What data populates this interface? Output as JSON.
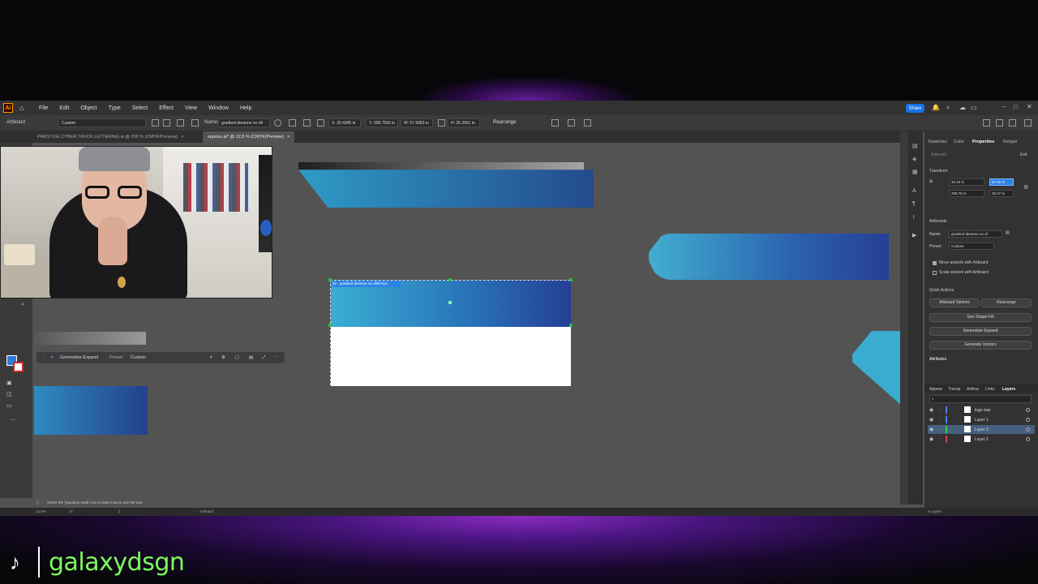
{
  "app": {
    "logo": "Ai"
  },
  "menu": [
    "File",
    "Edit",
    "Object",
    "Type",
    "Select",
    "Effect",
    "View",
    "Window",
    "Help"
  ],
  "share_label": "Share",
  "control": {
    "artboard": "Artboard",
    "preset": "Custom",
    "name_label": "Name:",
    "name_value": "gradient deneme no dil",
    "x": "X: 30.4345 in",
    "y": "Y: 208.7556 in",
    "w": "W: 57.9083 in",
    "h": "H: 25.2661 in",
    "rearrange": "Rearrange"
  },
  "tabs": [
    {
      "label": "PRESTIGE CYBER TRUCK LETTERING.ai @ 200 % (CMYK/Preview)",
      "active": false
    },
    {
      "label": "equnox.ai* @ 12.5 % (CMYK/Preview)",
      "active": true
    }
  ],
  "artboard_label": "02 - gradient deneme no dilher111",
  "generative_bar": {
    "title": "Generative Expand",
    "preset_label": "Preset:",
    "preset_value": "Custom"
  },
  "properties": {
    "tabs": [
      "Swatches",
      "Color",
      "Properties",
      "Retype"
    ],
    "selected_tab": "Properties",
    "section": "Artboard",
    "exit": "Exit",
    "transform": "Transform",
    "x": "30.43 in",
    "y": "208.76 in",
    "w": "57.91 in",
    "h": "25.27 in",
    "artboards": "Artboards",
    "name_label": "Name:",
    "name_value": "gradient deneme no dl",
    "preset_label": "Preset:",
    "preset_value": "Custom",
    "move_artwork": "Move artwork with Artboard",
    "scale_artwork": "Scale artwork with Artboard",
    "quick_actions": "Quick Actions",
    "btn_artboard_options": "Artboard Options",
    "btn_rearrange": "Rearrange",
    "btn_gen_shape_fill": "Gen Shape Fill",
    "btn_generative_expand": "Generative Expand",
    "btn_generate_vectors": "Generate Vectors",
    "attributes": "Attributes"
  },
  "layers_panel": {
    "tabs": [
      "Appear",
      "Transp",
      "Artboa",
      "Links",
      "Layers"
    ],
    "selected_tab": "Layers",
    "layers": [
      {
        "name": "logo mar",
        "color": "#4a7ef5",
        "selected": false
      },
      {
        "name": "Layer 1",
        "color": "#4a7ef5",
        "selected": false
      },
      {
        "name": "Layer 3",
        "color": "#2fd14a",
        "selected": true
      },
      {
        "name": "Layer 2",
        "color": "#d04040",
        "selected": false
      }
    ],
    "count": "4 Layers"
  },
  "statusbar": {
    "hint": "Select the 'Question mark' icon to learn how to use the tool.",
    "zoom": "12.5%",
    "rotation": "0°",
    "page": "2",
    "mode": "Artboard"
  },
  "watermark": {
    "handle": "galaxydsgn"
  },
  "colors": {
    "accent": "#1473e6",
    "handle_green": "#7bff5a",
    "gradient_start": "#3aaed3",
    "gradient_end": "#263f95"
  }
}
